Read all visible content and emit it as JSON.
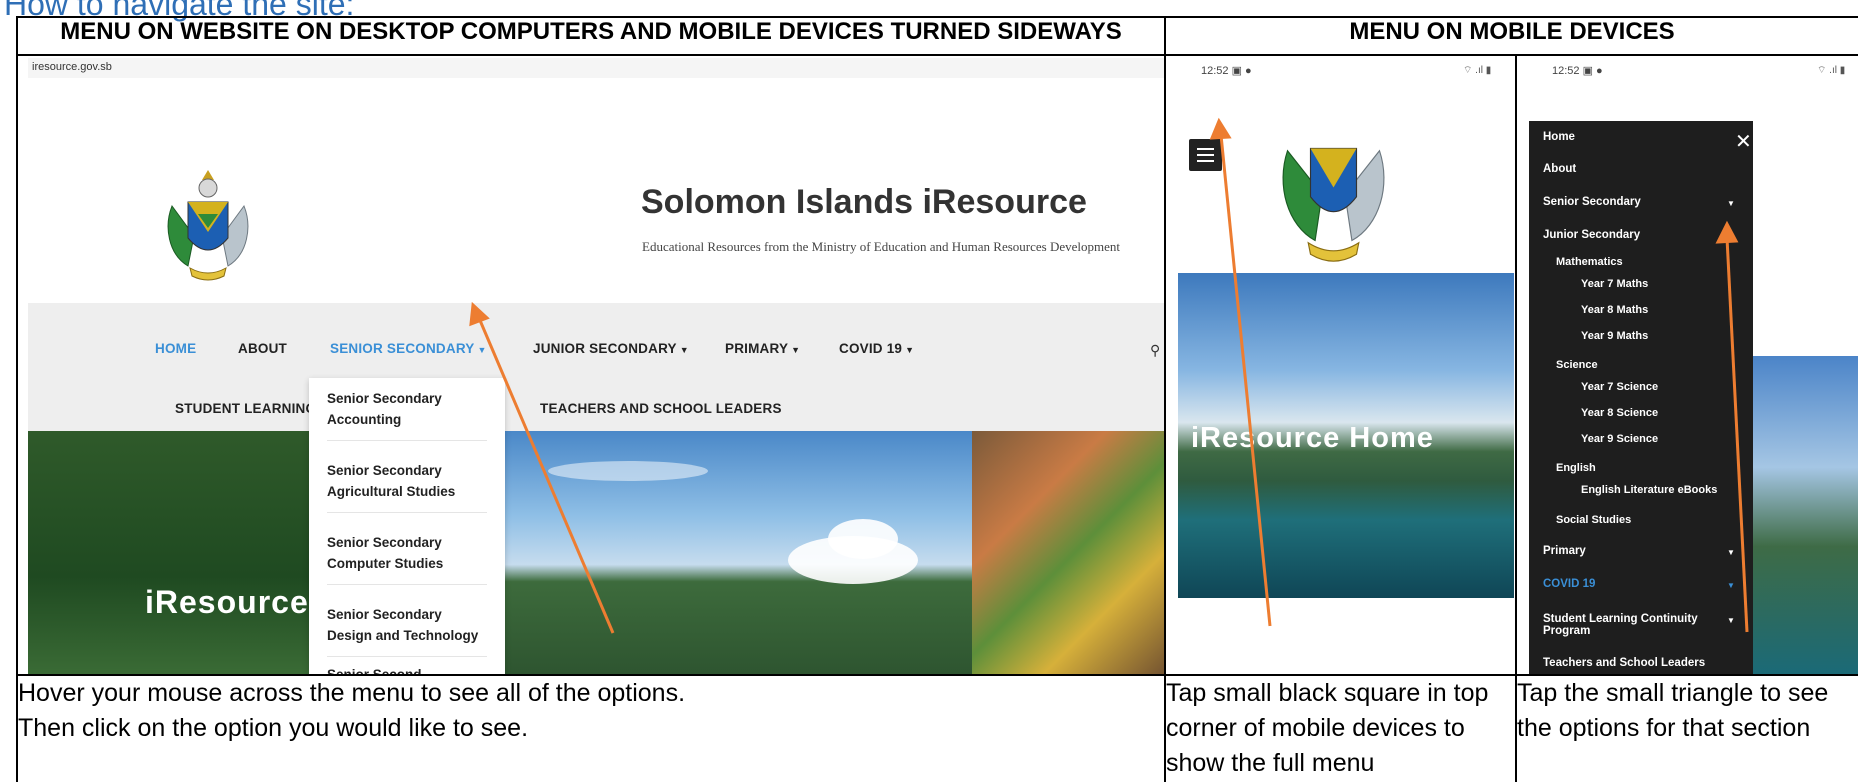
{
  "page_heading": "How to navigate the site:",
  "columns": {
    "desktop_header": "MENU ON WEBSITE ON DESKTOP COMPUTERS AND MOBILE DEVICES TURNED SIDEWAYS",
    "mobile_header": "MENU ON MOBILE DEVICES"
  },
  "desktop": {
    "url": "iresource.gov.sb",
    "site_title": "Solomon Islands iResource",
    "tagline": "Educational Resources from the Ministry of Education and Human Resources Development",
    "nav": {
      "home": "HOME",
      "about": "ABOUT",
      "senior": "SENIOR SECONDARY",
      "junior": "JUNIOR SECONDARY",
      "primary": "PRIMARY",
      "covid": "COVID 19",
      "student": "STUDENT LEARNING",
      "teachers": "TEACHERS AND SCHOOL LEADERS"
    },
    "dropdown": [
      {
        "line1": "Senior Secondary",
        "line2": "Accounting"
      },
      {
        "line1": "Senior Secondary",
        "line2": "Agricultural Studies"
      },
      {
        "line1": "Senior Secondary",
        "line2": "Computer Studies"
      },
      {
        "line1": "Senior Secondary",
        "line2": "Design and Technology"
      },
      {
        "line1": "Senior Second",
        "line2": ""
      }
    ],
    "hero_text": "iResource",
    "caption_line1": "Hover your mouse across the menu to see all of the options.",
    "caption_line2": "Then click on the option you would like to see."
  },
  "mobile1": {
    "time": "12:52",
    "hero_title": "iResource Home",
    "caption": "Tap small black square in top corner of mobile devices to show the full menu"
  },
  "mobile2": {
    "time": "12:52",
    "menu": {
      "home": "Home",
      "about": "About",
      "senior": "Senior Secondary",
      "junior": "Junior Secondary",
      "mathematics": "Mathematics",
      "y7m": "Year 7 Maths",
      "y8m": "Year 8 Maths",
      "y9m": "Year 9 Maths",
      "science": "Science",
      "y7s": "Year 7 Science",
      "y8s": "Year 8 Science",
      "y9s": "Year 9 Science",
      "english": "English",
      "ele": "English Literature eBooks",
      "social": "Social Studies",
      "primary": "Primary",
      "covid": "COVID 19",
      "slcp1": "Student Learning Continuity",
      "slcp2": "Program",
      "teachers": "Teachers and School Leaders"
    },
    "caption": "Tap the small triangle to see the options for that section"
  },
  "colors": {
    "accent_blue": "#3a8fd6",
    "arrow_orange": "#ed7d31",
    "heading_blue": "#2f6fb6"
  }
}
